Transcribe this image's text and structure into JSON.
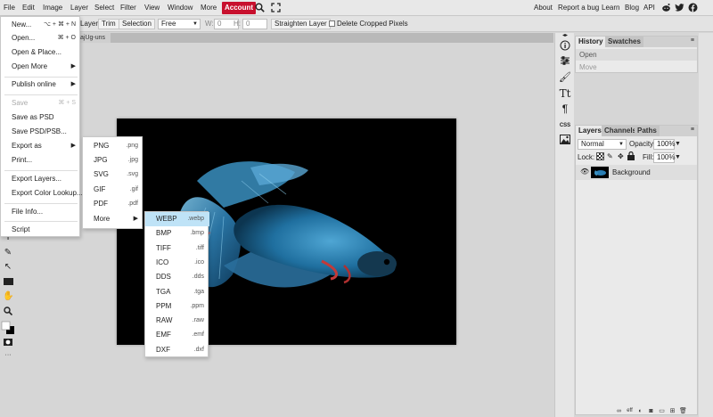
{
  "menubar": {
    "items": [
      "File",
      "Edit",
      "Image",
      "Layer",
      "Select",
      "Filter",
      "View",
      "Window",
      "More"
    ],
    "account": "Account",
    "right_links": [
      "About",
      "Report a bug",
      "Learn",
      "Blog",
      "API"
    ]
  },
  "options": {
    "layer": "Layer",
    "trim": "Trim",
    "selection": "Selection",
    "mode": "Free",
    "w_label": "W:",
    "w_value": "0",
    "h_label": "H:",
    "h_value": "0",
    "straighten": "Straighten Layer",
    "delete_cropped": "Delete Cropped Pixels"
  },
  "document": {
    "tab_label": "ajUg-uns"
  },
  "file_menu": {
    "items": [
      {
        "label": "New...",
        "shortcut": "⌥ + ⌘ + N"
      },
      {
        "label": "Open...",
        "shortcut": "⌘ + O"
      },
      {
        "label": "Open & Place..."
      },
      {
        "label": "Open More"
      },
      {
        "label": "Publish online"
      },
      {
        "label": "Save",
        "shortcut": "⌘ + S"
      },
      {
        "label": "Save as PSD"
      },
      {
        "label": "Save PSD/PSB..."
      },
      {
        "label": "Export as"
      },
      {
        "label": "Print..."
      },
      {
        "label": "Export Layers..."
      },
      {
        "label": "Export Color Lookup..."
      },
      {
        "label": "File Info..."
      },
      {
        "label": "Script"
      }
    ]
  },
  "export_menu": {
    "items": [
      {
        "label": "PNG",
        "ext": ".png"
      },
      {
        "label": "JPG",
        "ext": ".jpg"
      },
      {
        "label": "SVG",
        "ext": ".svg"
      },
      {
        "label": "GIF",
        "ext": ".gif"
      },
      {
        "label": "PDF",
        "ext": ".pdf"
      },
      {
        "label": "More"
      }
    ]
  },
  "more_menu": {
    "items": [
      {
        "label": "WEBP",
        "ext": ".webp"
      },
      {
        "label": "BMP",
        "ext": ".bmp"
      },
      {
        "label": "TIFF",
        "ext": ".tiff"
      },
      {
        "label": "ICO",
        "ext": ".ico"
      },
      {
        "label": "DDS",
        "ext": ".dds"
      },
      {
        "label": "TGA",
        "ext": ".tga"
      },
      {
        "label": "PPM",
        "ext": ".ppm"
      },
      {
        "label": "RAW",
        "ext": ".raw"
      },
      {
        "label": "EMF",
        "ext": ".emf"
      },
      {
        "label": "DXF",
        "ext": ".dxf"
      }
    ]
  },
  "history_panel": {
    "tabs": [
      "History",
      "Swatches"
    ],
    "entries": [
      "Open",
      "Move"
    ]
  },
  "layers_panel": {
    "tabs": [
      "Layers",
      "Channels",
      "Paths"
    ],
    "blend_mode": "Normal",
    "opacity_label": "Opacity:",
    "opacity_value": "100%",
    "lock_label": "Lock:",
    "fill_label": "Fill:",
    "fill_value": "100%",
    "layer_name": "Background"
  },
  "sidebar": {
    "css_label": "CSS"
  },
  "colors": {
    "accent": "#c8102e",
    "highlight": "#bfe3f7",
    "canvas_bg": "#000000",
    "fish_blue": "#2a7fb5"
  }
}
